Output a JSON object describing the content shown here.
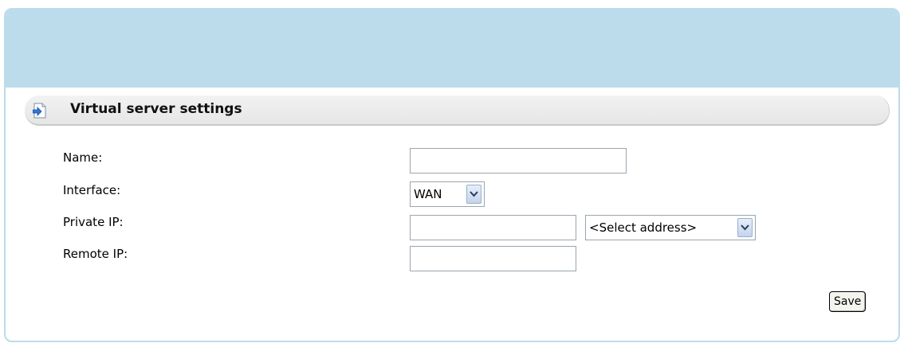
{
  "section": {
    "title": "Virtual server settings",
    "icon": "page-arrow-icon"
  },
  "form": {
    "name_label": "Name:",
    "name_value": "",
    "interface_label": "Interface:",
    "interface_selected": "WAN",
    "private_ip_label": "Private IP:",
    "private_ip_value": "",
    "private_ip_select": "<Select address>",
    "remote_ip_label": "Remote IP:",
    "remote_ip_value": ""
  },
  "actions": {
    "save_label": "Save"
  },
  "colors": {
    "header_bg": "#bcdcec",
    "section_bar_bg": "#eeeeee"
  }
}
